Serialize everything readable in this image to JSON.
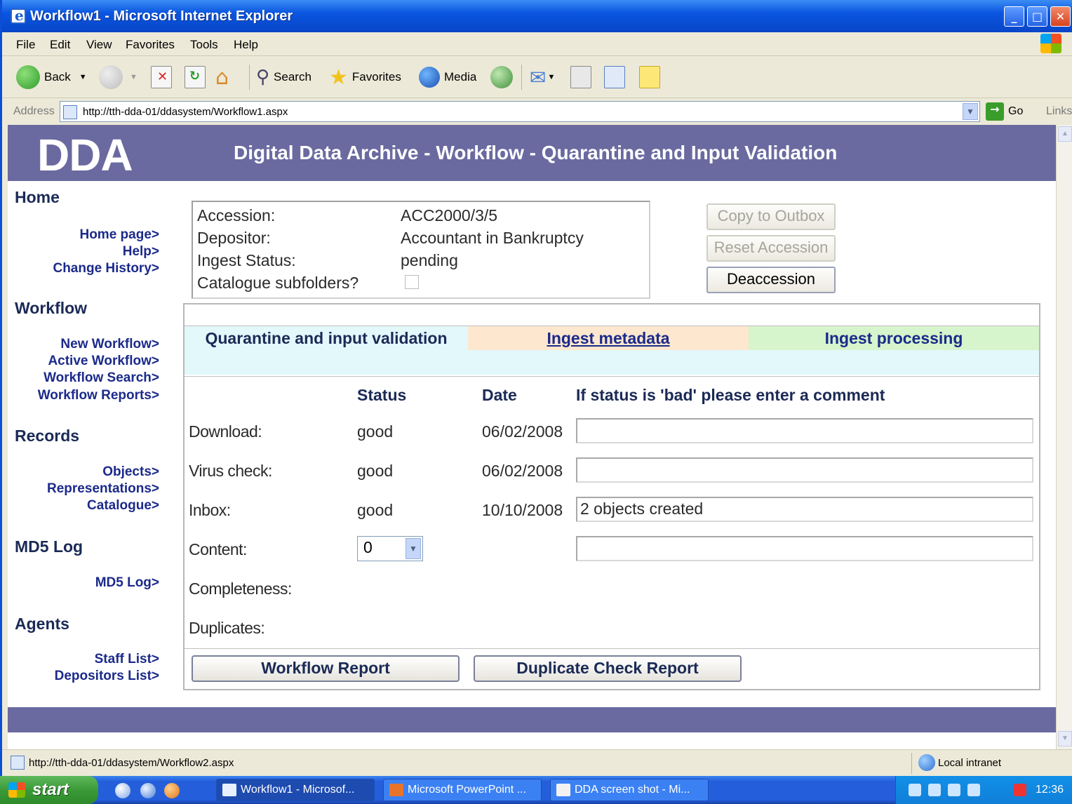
{
  "window": {
    "title": "Workflow1 - Microsoft Internet Explorer",
    "controls": [
      "minimize",
      "maximize",
      "close"
    ]
  },
  "menu": [
    "File",
    "Edit",
    "View",
    "Favorites",
    "Tools",
    "Help"
  ],
  "toolbar": {
    "back": "Back",
    "search": "Search",
    "favorites": "Favorites",
    "media": "Media"
  },
  "address": {
    "label": "Address",
    "url": "http://tth-dda-01/ddasystem/Workflow1.aspx",
    "go": "Go",
    "links": "Links"
  },
  "banner": {
    "logo": "DDA",
    "title": "Digital Data Archive - Workflow - Quarantine and Input Validation"
  },
  "nav": {
    "home_heading": "Home",
    "home_links": [
      "Home page>",
      "Help>",
      "Change History>"
    ],
    "workflow_heading": "Workflow",
    "workflow_links": [
      "New Workflow>",
      "Active Workflow>",
      "Workflow Search>",
      "Workflow Reports>"
    ],
    "records_heading": "Records",
    "records_links": [
      "Objects>",
      "Representations>",
      "Catalogue>"
    ],
    "md5_heading": "MD5 Log",
    "md5_links": [
      "MD5 Log>"
    ],
    "agents_heading": "Agents",
    "agents_links": [
      "Staff List>",
      "Depositors List>"
    ]
  },
  "accession": {
    "accession_label": "Accession:",
    "accession_value": "ACC2000/3/5",
    "depositor_label": "Depositor:",
    "depositor_value": "Accountant in Bankruptcy",
    "status_label": "Ingest Status:",
    "status_value": "pending",
    "subfolders_label": "Catalogue subfolders?"
  },
  "actions": {
    "copy": "Copy to Outbox",
    "reset": "Reset Accession",
    "deaccession": "Deaccession"
  },
  "steps": {
    "step1": "Quarantine and input validation",
    "step2": "Ingest metadata",
    "step3": "Ingest processing"
  },
  "table": {
    "col_status": "Status",
    "col_date": "Date",
    "col_comment": "If status is 'bad' please enter a comment",
    "rows": [
      {
        "label": "Download:",
        "status": "good",
        "date": "06/02/2008",
        "comment": ""
      },
      {
        "label": "Virus check:",
        "status": "good",
        "date": "06/02/2008",
        "comment": ""
      },
      {
        "label": "Inbox:",
        "status": "good",
        "date": "10/10/2008",
        "comment": "2 objects created"
      },
      {
        "label": "Content:",
        "select": "0",
        "comment": ""
      },
      {
        "label": "Completeness:"
      },
      {
        "label": "Duplicates:"
      }
    ]
  },
  "buttons": {
    "workflow_report": "Workflow Report",
    "duplicate_report": "Duplicate Check Report"
  },
  "statusbar": {
    "url": "http://tth-dda-01/ddasystem/Workflow2.aspx",
    "zone": "Local intranet"
  },
  "taskbar": {
    "start": "start",
    "tasks": [
      "Workflow1 - Microsof...",
      "Microsoft PowerPoint ...",
      "DDA screen shot - Mi..."
    ],
    "clock": "12:36"
  }
}
